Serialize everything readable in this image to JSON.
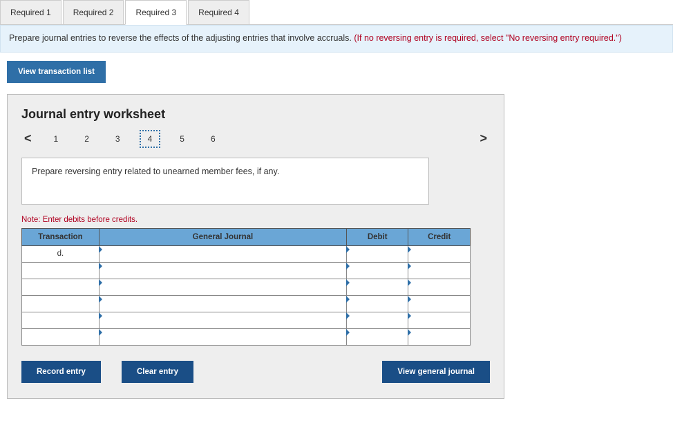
{
  "tabs": {
    "items": [
      {
        "label": "Required 1"
      },
      {
        "label": "Required 2"
      },
      {
        "label": "Required 3"
      },
      {
        "label": "Required 4"
      }
    ],
    "active_index": 2
  },
  "instruction": {
    "black": "Prepare journal entries to reverse the effects of the adjusting entries that involve accruals. ",
    "red": "(If no reversing entry is required, select \"No reversing entry required.\")"
  },
  "buttons": {
    "view_list": "View transaction list",
    "record": "Record entry",
    "clear": "Clear entry",
    "view_journal": "View general journal"
  },
  "worksheet": {
    "title": "Journal entry worksheet",
    "pager": {
      "prev": "<",
      "next": ">",
      "nums": [
        "1",
        "2",
        "3",
        "4",
        "5",
        "6"
      ],
      "selected": "4"
    },
    "prompt": "Prepare reversing entry related to unearned member fees, if any.",
    "note": "Note: Enter debits before credits.",
    "headers": {
      "txn": "Transaction",
      "gj": "General Journal",
      "debit": "Debit",
      "credit": "Credit"
    },
    "rows": [
      {
        "txn": "d.",
        "gj": "",
        "debit": "",
        "credit": ""
      },
      {
        "txn": "",
        "gj": "",
        "debit": "",
        "credit": ""
      },
      {
        "txn": "",
        "gj": "",
        "debit": "",
        "credit": ""
      },
      {
        "txn": "",
        "gj": "",
        "debit": "",
        "credit": ""
      },
      {
        "txn": "",
        "gj": "",
        "debit": "",
        "credit": ""
      },
      {
        "txn": "",
        "gj": "",
        "debit": "",
        "credit": ""
      }
    ]
  }
}
